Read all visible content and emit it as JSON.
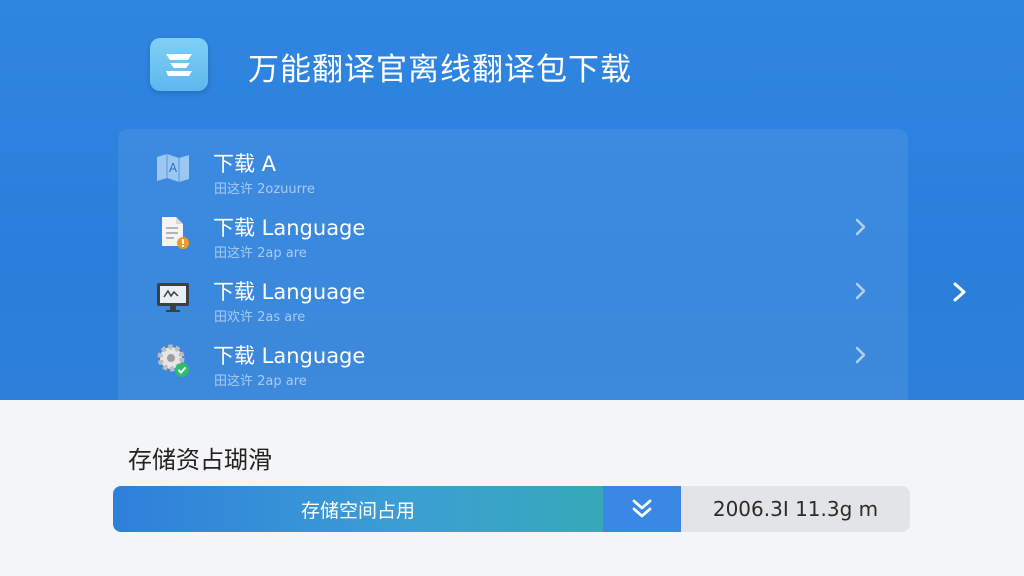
{
  "header": {
    "title": "万能翻译官离线翻译包下载",
    "app_icon": "app-logo-icon"
  },
  "list": {
    "items": [
      {
        "title": "下载 A",
        "subtitle": "田这许 2ozuurre",
        "icon": "map-translate-icon",
        "has_chevron": false
      },
      {
        "title": "下载 Language",
        "subtitle": "田这许 2ap are",
        "icon": "document-alert-icon",
        "has_chevron": true
      },
      {
        "title": "下载 Language",
        "subtitle": "田欢许 2as are",
        "icon": "monitor-icon",
        "has_chevron": true
      },
      {
        "title": "下载 Language",
        "subtitle": "田这许 2ap are",
        "icon": "gear-check-icon",
        "has_chevron": true
      }
    ]
  },
  "storage": {
    "label": "存储资占瑚滑",
    "bar_label": "存储空间占用",
    "value": "2006.3I 11.3g m",
    "fill_fraction": 0.61
  },
  "colors": {
    "header_bg": "#2f86e0",
    "bar_fill_start": "#2f7fdb",
    "bar_fill_end": "#36a9b9",
    "bar_button": "#3a87e6"
  }
}
